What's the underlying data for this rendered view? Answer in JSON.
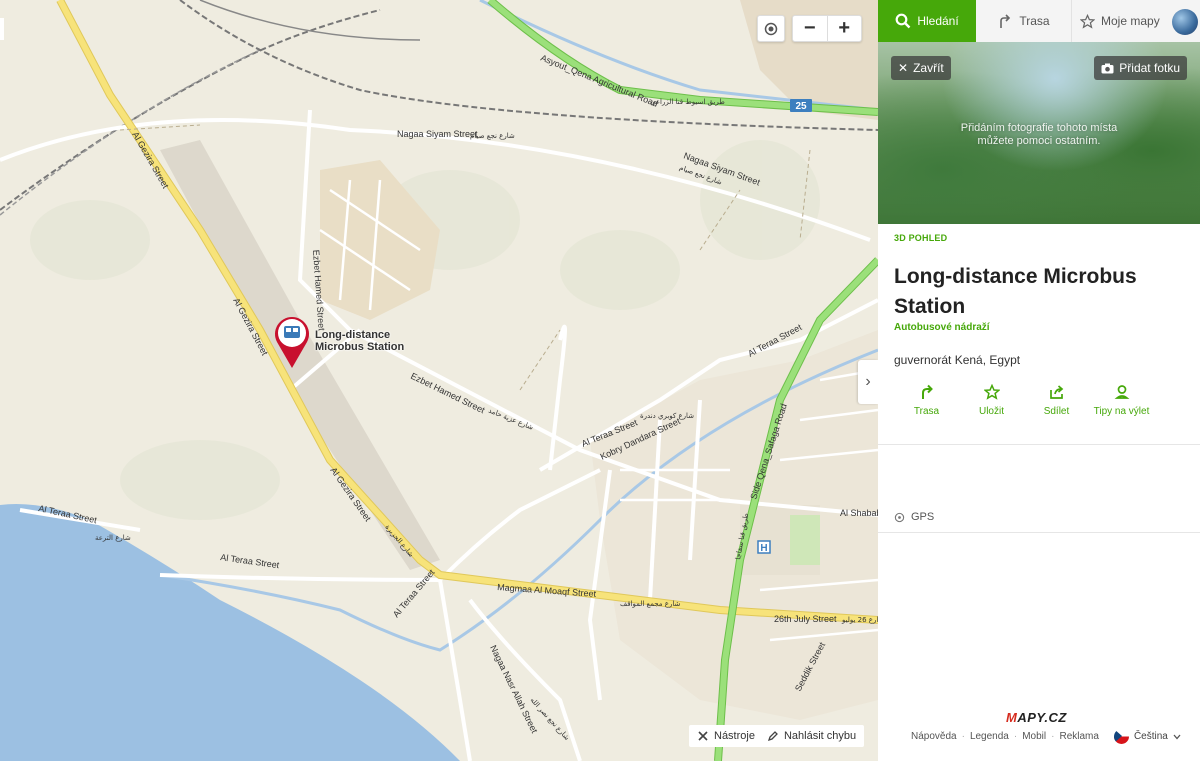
{
  "map": {
    "roads": {
      "asyout_qena": "Asyout_Qena Agricultural Road",
      "asyout_qena_ar": "طريق اسيوط قنا الزراعي",
      "route_number": "25",
      "nagaa_siyam_1": "Nagaa Siyam Street",
      "nagaa_siyam_1_ar": "شارع نجع صيام",
      "nagaa_siyam_2": "Nagaa Siyam Street",
      "nagaa_siyam_2_ar": "شارع نجع صيام",
      "al_gezira_1": "Al Gezira Street",
      "al_gezira_1_ar": "شارع الجزيرة",
      "al_gezira_2": "Al Gezira Street",
      "al_gezira_2_ar": "شارع الجزيرة",
      "al_gezira_3": "Al Gezira Street",
      "al_gezira_3_ar": "شارع الجزيرة",
      "ezbet_hamed_1": "Ezbet Hamed Street",
      "ezbet_hamed_1_ar": "شارع عزبة حامد",
      "ezbet_hamed_2": "Ezbet Hamed Street",
      "ezbet_hamed_2_ar": "شارع عزبة حامد",
      "al_teraa_1": "Al Teraa Street",
      "al_teraa_2": "Al Teraa Street",
      "al_teraa_3": "Al Teraa Street",
      "al_teraa_4": "Al Teraa Street",
      "al_teraa_5": "Al Teraa Street",
      "al_teraa_ar": "شارع الترعة",
      "kobry_dandara": "Kobry Dandara Street",
      "kobry_dandara_ar": "شارع كوبري دندرة",
      "magmaa": "Magmaa Al Moaqf Street",
      "magmaa_ar": "شارع مجمع المواقف",
      "july26": "26th July Street",
      "july26_ar": "شارع 26 يوليو",
      "al_shabab": "Al Shabab",
      "safaga": "Side Qena_Safaga Road",
      "safaga_ar": "طريق قنا سفاجا",
      "nasr_allah": "Nagaa Nasr Allah Street",
      "nasr_allah_ar": "شارع نجع نصر الله",
      "seddik": "Seddik Street"
    },
    "poi": {
      "label_line1": "Long-distance",
      "label_line2": "Microbus Station"
    },
    "hospital": "H",
    "controls": {
      "zoom_out": "−",
      "zoom_in": "+",
      "collapse": "›"
    },
    "tools": {
      "tools_label": "Nástroje",
      "report_label": "Nahlásit chybu"
    }
  },
  "sidebar": {
    "tabs": [
      {
        "label": "Hledání",
        "icon": "search-icon"
      },
      {
        "label": "Trasa",
        "icon": "route-icon"
      },
      {
        "label": "Moje mapy",
        "icon": "star-icon"
      }
    ],
    "photo": {
      "close_label": "Zavřít",
      "add_photo_label": "Přidat fotku",
      "hint_line1": "Přidáním fotografie tohoto místa",
      "hint_line2": "můžete pomoci ostatním."
    },
    "view_3d": "3D POHLED",
    "title": "Long-distance Microbus Station",
    "category": "Autobusové nádraží",
    "address": "guvernorát Kená, Egypt",
    "actions": [
      {
        "label": "Trasa",
        "icon": "route-arrow-icon"
      },
      {
        "label": "Uložit",
        "icon": "star-outline-icon"
      },
      {
        "label": "Sdílet",
        "icon": "share-icon"
      },
      {
        "label": "Tipy na výlet",
        "icon": "trip-pin-icon"
      }
    ],
    "gps_label": "GPS",
    "logo": {
      "m": "M",
      "rest": "APY.CZ"
    },
    "footer": {
      "links": [
        "Nápověda",
        "Legenda",
        "Mobil",
        "Reklama"
      ],
      "separator": "·",
      "language": "Čeština"
    }
  },
  "colors": {
    "brand_green": "#46a80a",
    "pin_red": "#c8102e",
    "water": "#9cc0e2",
    "yellow_road": "#f7e37a",
    "green_road": "#8bd66b"
  }
}
